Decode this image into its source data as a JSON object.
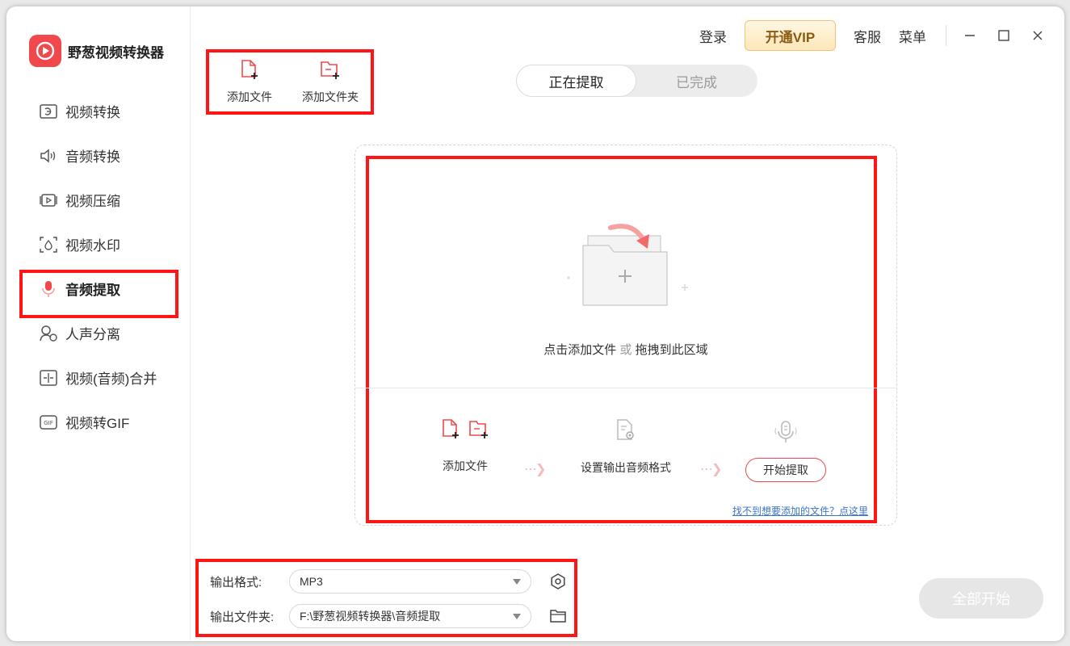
{
  "app": {
    "name": "野葱视频转换器"
  },
  "topbar": {
    "login": "登录",
    "vip": "开通VIP",
    "service": "客服",
    "menu": "菜单"
  },
  "sidebar": {
    "items": [
      {
        "label": "视频转换",
        "icon": "video-convert-icon"
      },
      {
        "label": "音频转换",
        "icon": "audio-convert-icon"
      },
      {
        "label": "视频压缩",
        "icon": "video-compress-icon"
      },
      {
        "label": "视频水印",
        "icon": "watermark-icon"
      },
      {
        "label": "音频提取",
        "icon": "microphone-icon",
        "active": true
      },
      {
        "label": "人声分离",
        "icon": "voice-separate-icon"
      },
      {
        "label": "视频(音频)合并",
        "icon": "merge-icon"
      },
      {
        "label": "视频转GIF",
        "icon": "gif-icon"
      }
    ]
  },
  "toolbar": {
    "add_file": "添加文件",
    "add_folder": "添加文件夹"
  },
  "tabs": {
    "extracting": "正在提取",
    "completed": "已完成"
  },
  "dropzone": {
    "hint_click": "点击添加文件",
    "hint_or": "或",
    "hint_drag": "拖拽到此区域",
    "step1": "添加文件",
    "step2": "设置输出音频格式",
    "step3": "开始提取",
    "help_link": "找不到想要添加的文件？点这里"
  },
  "output": {
    "format_label": "输出格式:",
    "format_value": "MP3",
    "folder_label": "输出文件夹:",
    "folder_value": "F:\\野葱视频转换器\\音频提取"
  },
  "start_all": "全部开始",
  "colors": {
    "accent": "#f0484d",
    "highlight": "#ff1515",
    "link": "#3b74c8"
  }
}
